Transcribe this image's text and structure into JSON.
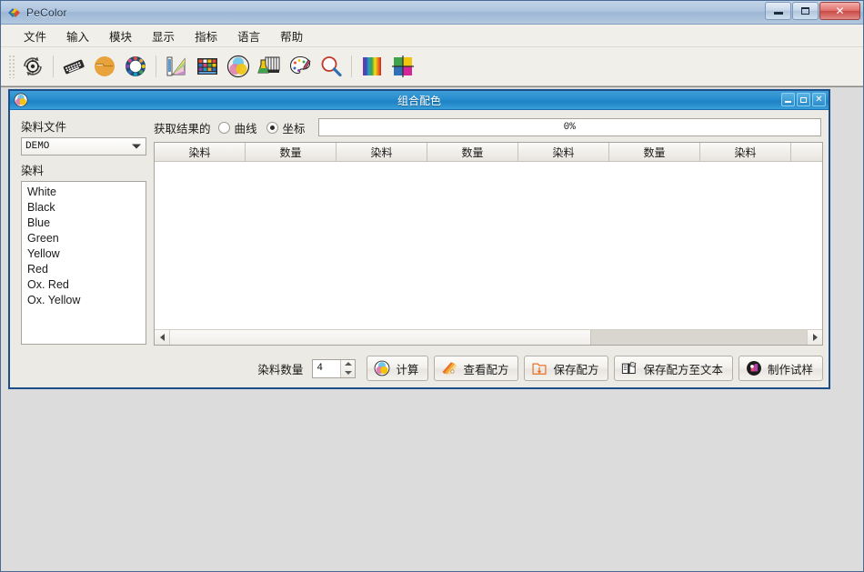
{
  "app": {
    "title": "PeColor",
    "icon": "pecolor-logo-icon"
  },
  "window_controls": {
    "minimize": "minimize-button",
    "maximize": "maximize-button",
    "close": "close-button"
  },
  "menu": {
    "items": [
      {
        "label": "文件"
      },
      {
        "label": "输入"
      },
      {
        "label": "模块"
      },
      {
        "label": "显示"
      },
      {
        "label": "指标"
      },
      {
        "label": "语言"
      },
      {
        "label": "帮助"
      }
    ]
  },
  "toolbar": {
    "buttons": [
      {
        "name": "settings-refresh-icon",
        "title": "设置"
      },
      {
        "name": "keyboard-icon",
        "title": "输入"
      },
      {
        "name": "folder-open-icon",
        "title": "打开"
      },
      {
        "name": "color-wheel-icon",
        "title": "配色"
      },
      {
        "name": "color-fan-icon",
        "title": "色卡"
      },
      {
        "name": "color-chart-icon",
        "title": "色表"
      },
      {
        "name": "venn-color-icon",
        "title": "组合配色"
      },
      {
        "name": "lab-equipment-icon",
        "title": "试样"
      },
      {
        "name": "palette-icon",
        "title": "调色板"
      },
      {
        "name": "magnifier-icon",
        "title": "查找"
      },
      {
        "name": "spectrum-icon",
        "title": "光谱"
      },
      {
        "name": "color-grid-icon",
        "title": "色域"
      }
    ]
  },
  "child_window": {
    "title": "组合配色",
    "icon": "venn-color-icon"
  },
  "left_panel": {
    "file_label": "染料文件",
    "file_value": "DEMO",
    "dye_label": "染料",
    "dyes": [
      "White",
      "Black",
      "Blue",
      "Green",
      "Yellow",
      "Red",
      "Ox. Red",
      "Ox. Yellow"
    ]
  },
  "result_row": {
    "label": "获取结果的",
    "option_curve": "曲线",
    "option_coord": "坐标",
    "selected": "坐标",
    "progress_text": "0%",
    "progress_percent": 0
  },
  "grid": {
    "headers": [
      "染料",
      "数量",
      "染料",
      "数量",
      "染料",
      "数量",
      "染料",
      ""
    ],
    "rows": []
  },
  "scrollbar": {
    "left_arrow": "scroll-left-icon",
    "right_arrow": "scroll-right-icon",
    "thumb_percent": 66
  },
  "action_bar": {
    "count_label": "染料数量",
    "count_value": "4",
    "buttons": [
      {
        "label": "计算",
        "icon": "venn-color-icon"
      },
      {
        "label": "查看配方",
        "icon": "color-fan-icon"
      },
      {
        "label": "保存配方",
        "icon": "save-down-icon"
      },
      {
        "label": "保存配方至文本",
        "icon": "book-text-icon"
      },
      {
        "label": "制作试样",
        "icon": "sample-ball-icon"
      }
    ]
  },
  "colors": {
    "titlebar": "#aec4de",
    "child_titlebar": "#2a8fd0",
    "child_border": "#1d4e8c",
    "toolbar_bg": "#f1efe9",
    "mdi_bg": "#dcdcdc",
    "close_red": "#c94a45"
  }
}
